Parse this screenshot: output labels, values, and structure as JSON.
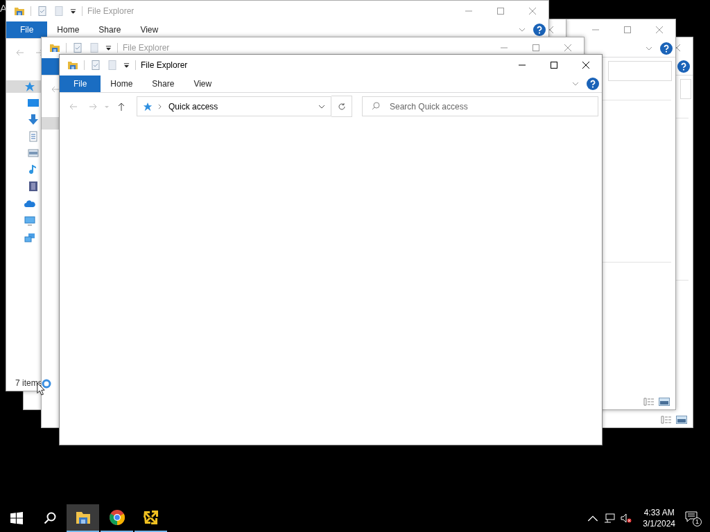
{
  "desktop": {
    "corner_text": "A"
  },
  "windows": [
    {
      "active": false,
      "loaded": true
    },
    {
      "active": false,
      "loaded": true
    },
    {
      "active": false
    },
    {
      "active": false,
      "title": "File Explorer",
      "tabs": [
        {
          "label": "File",
          "selected": true
        },
        {
          "label": "Home",
          "selected": false
        },
        {
          "label": "Share",
          "selected": false
        },
        {
          "label": "View",
          "selected": false
        }
      ],
      "sidebar": [
        {
          "kind": "quick-access",
          "selected": true,
          "children": [
            {
              "kind": "desktop",
              "selected": false
            },
            {
              "kind": "downloads",
              "selected": false
            },
            {
              "kind": "documents",
              "selected": false
            },
            {
              "kind": "pictures",
              "selected": false
            },
            {
              "kind": "music",
              "selected": false
            },
            {
              "kind": "videos",
              "selected": false
            }
          ]
        },
        {
          "kind": "onedrive",
          "selected": false
        },
        {
          "kind": "this-pc",
          "selected": false
        },
        {
          "kind": "network",
          "selected": false
        }
      ],
      "status": "7 items"
    },
    {
      "active": false,
      "title": "File Explorer",
      "tabs": [
        {
          "selected": true
        }
      ],
      "sidebar": [
        {
          "kind": "quick-access",
          "selected": true
        }
      ]
    },
    {
      "active": true,
      "title": "File Explorer",
      "tabs": [
        {
          "label": "File",
          "selected": true
        },
        {
          "label": "Home",
          "selected": false
        },
        {
          "label": "Share",
          "selected": false
        },
        {
          "label": "View",
          "selected": false
        }
      ],
      "address": "Quick access",
      "search": {
        "placeholder": "Search Quick access"
      }
    }
  ],
  "taskbar": {
    "apps": [
      {
        "kind": "file-explorer",
        "selected": true
      },
      {
        "kind": "chrome",
        "selected": false
      },
      {
        "kind": "yellow-app",
        "selected": false
      }
    ],
    "time": "4:33 AM",
    "date": "3/1/2024",
    "notification_count": "1"
  }
}
